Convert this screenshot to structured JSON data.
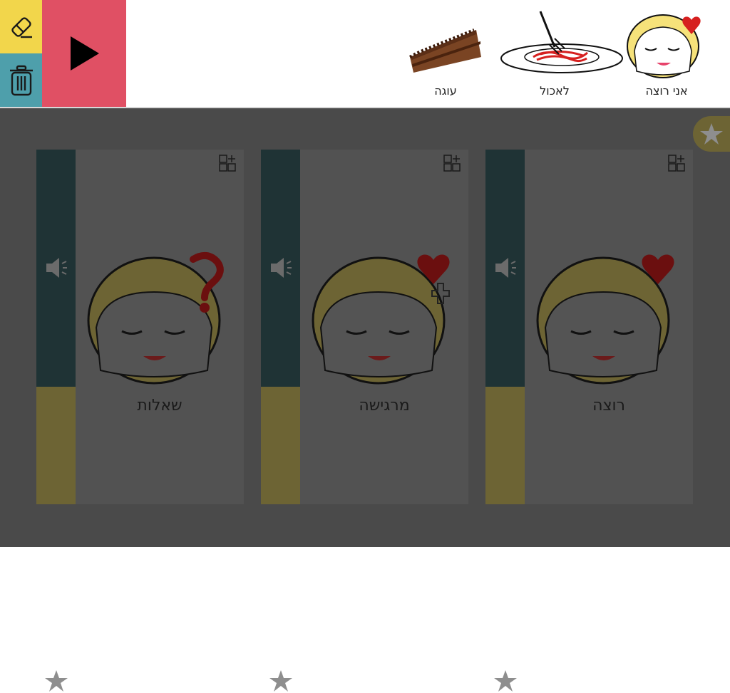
{
  "toolbar": {
    "eraser_icon": "eraser-icon",
    "trash_icon": "trash-icon",
    "play_icon": "play-icon"
  },
  "sentence": [
    {
      "label": "אני רוצה",
      "icon": "girl-heart-icon"
    },
    {
      "label": "לאכול",
      "icon": "spaghetti-plate-icon"
    },
    {
      "label": "עוגה",
      "icon": "chocolate-cake-icon"
    }
  ],
  "favorites_tab": {
    "icon": "star-icon"
  },
  "cards": [
    {
      "label": "רוצה",
      "icon": "girl-heart-icon",
      "has_plus_badge": false
    },
    {
      "label": "מרגישה",
      "icon": "girl-heart-icon",
      "has_plus_badge": true
    },
    {
      "label": "שאלות",
      "icon": "girl-question-icon",
      "has_plus_badge": false
    }
  ],
  "colors": {
    "eraser_bg": "#f2d64b",
    "trash_bg": "#4e9fab",
    "play_bg": "#e05064",
    "card_side_top": "#1f3335",
    "card_side_bottom": "#6d6434",
    "overlay": "#4a4a4a"
  }
}
